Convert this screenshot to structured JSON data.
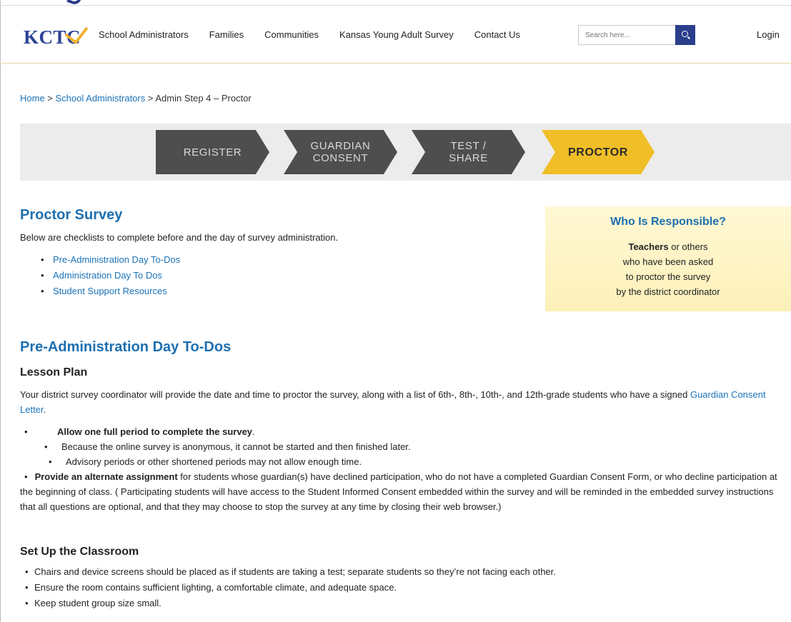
{
  "header": {
    "logo_text": "KCTC",
    "menu": [
      "School Administrators",
      "Families",
      "Communities",
      "Kansas Young Adult Survey",
      "Contact Us"
    ],
    "search_placeholder": "Search here...",
    "login": "Login"
  },
  "breadcrumb": {
    "home": "Home",
    "sep1": " > ",
    "admins": "School Administrators",
    "sep2": " > ",
    "current": "Admin Step 4 – Proctor"
  },
  "steps": [
    {
      "line1": "REGISTER",
      "line2": ""
    },
    {
      "line1": "GUARDIAN",
      "line2": "CONSENT"
    },
    {
      "line1": "TEST /",
      "line2": "SHARE"
    },
    {
      "line1": "PROCTOR",
      "line2": ""
    }
  ],
  "proctor": {
    "title": "Proctor Survey",
    "intro": "Below are checklists to complete before and the day of survey administration.",
    "links": [
      "Pre-Administration Day To-Dos",
      "Administration Day To Dos",
      "Student Support Resources"
    ]
  },
  "callout": {
    "title": "Who Is Responsible?",
    "bold": "Teachers",
    "line1_rest": " or others",
    "line2": "who have been asked",
    "line3": "to proctor the survey",
    "line4": "by the district coordinator"
  },
  "pre_admin": {
    "title": "Pre-Administration Day To-Dos",
    "lesson_title": "Lesson Plan",
    "para_before": "Your district survey coordinator will provide the date and time to proctor the survey, along with a list of 6th-, 8th-, 10th-, and 12th-grade students who have a signed ",
    "para_link": "Guardian Consent Letter",
    "para_after": ".",
    "item1_bold": "Allow one full period to complete the survey",
    "item1_rest": ".",
    "item2": "Because the online survey is anonymous, it cannot be started and then finished later.",
    "item3": "Advisory periods or other shortened periods may not allow enough time.",
    "item4_bold": "Provide an alternate assignment",
    "item4_rest": "  for students whose guardian(s) have declined participation, who do not have a completed Guardian Consent Form, or who decline participation at the beginning of class. (  Participating students will have access to the Student Informed Consent embedded within the survey and will be reminded in the embedded survey instructions that all questions are optional, and that they may choose to stop the survey at any time by closing their web browser.)"
  },
  "setup": {
    "title": "Set Up the Classroom",
    "items": [
      "Chairs and device screens should be placed as if students are taking a test; separate students so they’re not facing each other.",
      "Ensure the room contains sufficient lighting, a comfortable climate, and adequate space.",
      "Keep student group size small."
    ]
  },
  "bullet": "•",
  "colors": {
    "brand_blue": "#2d4396",
    "link_blue": "#1a73b8",
    "accent_yellow": "#f0be27",
    "step_gray": "#4e4e4e"
  }
}
